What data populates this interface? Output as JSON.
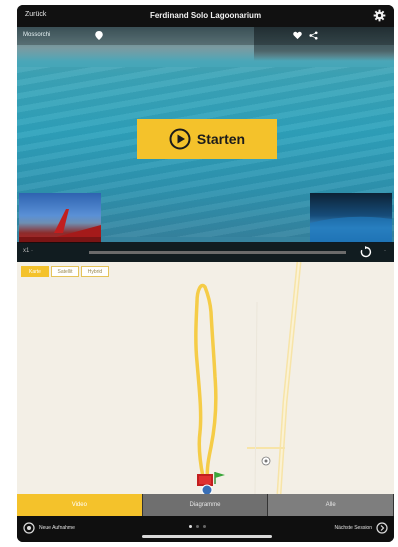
{
  "header": {
    "back_label": "Zurück",
    "title": "Ferdinand Solo Lagoonarium"
  },
  "video": {
    "location_label": "Mossorchi",
    "start_label": "Starten",
    "speed_label": "x1 ·",
    "replay_label": "·",
    "progress": 0.0
  },
  "map": {
    "tabs": [
      "Karte",
      "Satellit",
      "Hybrid"
    ]
  },
  "modes": [
    "Video",
    "Diagramme",
    "Alle"
  ],
  "footer": {
    "new_session_label": "Neue Aufnahme",
    "next_session_label": "Nächste Session"
  },
  "colors": {
    "accent": "#f4c22b",
    "track": "#f5cc47",
    "water": "#2fa3bd"
  }
}
